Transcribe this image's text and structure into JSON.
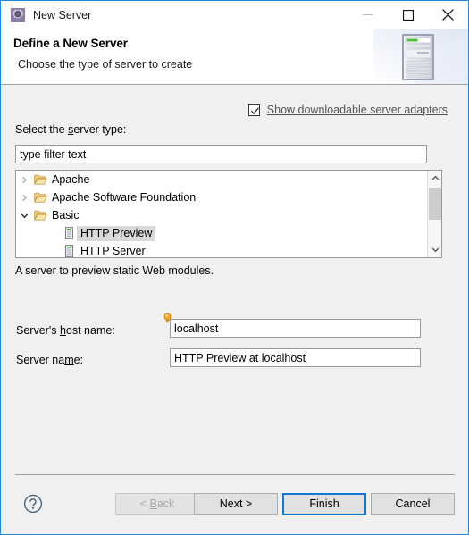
{
  "window": {
    "title": "New Server",
    "icon": "gear-icon",
    "border_color": "#2288dd",
    "controls": {
      "minimize": "minimize-icon",
      "maximize": "maximize-icon",
      "close": "close-icon"
    }
  },
  "header": {
    "title": "Define a New Server",
    "subtitle": "Choose the type of server to create",
    "art_icon": "server-tower-icon"
  },
  "adapters": {
    "checked": true,
    "label": "Show downloadable server adapters"
  },
  "server_type": {
    "label_prefix": "Select the ",
    "label_mnemonic": "s",
    "label_suffix": "erver type:",
    "filter_value": "type filter text",
    "filter_placeholder": "type filter text",
    "description": "A server to preview static Web modules.",
    "tree": [
      {
        "label": "Apache",
        "level": 0,
        "icon": "folder-icon",
        "twisty": "chevron-right-icon",
        "expanded": false,
        "selected": false
      },
      {
        "label": "Apache Software Foundation",
        "level": 0,
        "icon": "folder-icon",
        "twisty": "chevron-right-icon",
        "expanded": false,
        "selected": false
      },
      {
        "label": "Basic",
        "level": 0,
        "icon": "folder-icon",
        "twisty": "chevron-down-icon",
        "expanded": true,
        "selected": false
      },
      {
        "label": "HTTP Preview",
        "level": 1,
        "icon": "server-icon",
        "twisty": "none",
        "expanded": false,
        "selected": true
      },
      {
        "label": "HTTP Server",
        "level": 1,
        "icon": "server-icon",
        "twisty": "none",
        "expanded": false,
        "selected": false
      }
    ],
    "scrollbar": {
      "up": "chevron-up-icon",
      "down": "chevron-down-icon"
    }
  },
  "form": {
    "host": {
      "label_prefix": "Server's ",
      "label_mnemonic": "h",
      "label_suffix": "ost name:",
      "value": "localhost",
      "hint_icon": "lightbulb-icon"
    },
    "name": {
      "label_prefix": "Server na",
      "label_mnemonic": "m",
      "label_suffix": "e:",
      "value": "HTTP Preview at localhost"
    }
  },
  "footer": {
    "help": "help-icon",
    "buttons": {
      "back_prefix": "< ",
      "back_mnemonic": "B",
      "back_suffix": "ack",
      "next": "Next >",
      "finish": "Finish",
      "cancel": "Cancel"
    },
    "default_button": "Finish",
    "default_border_color": "#1277d3"
  }
}
